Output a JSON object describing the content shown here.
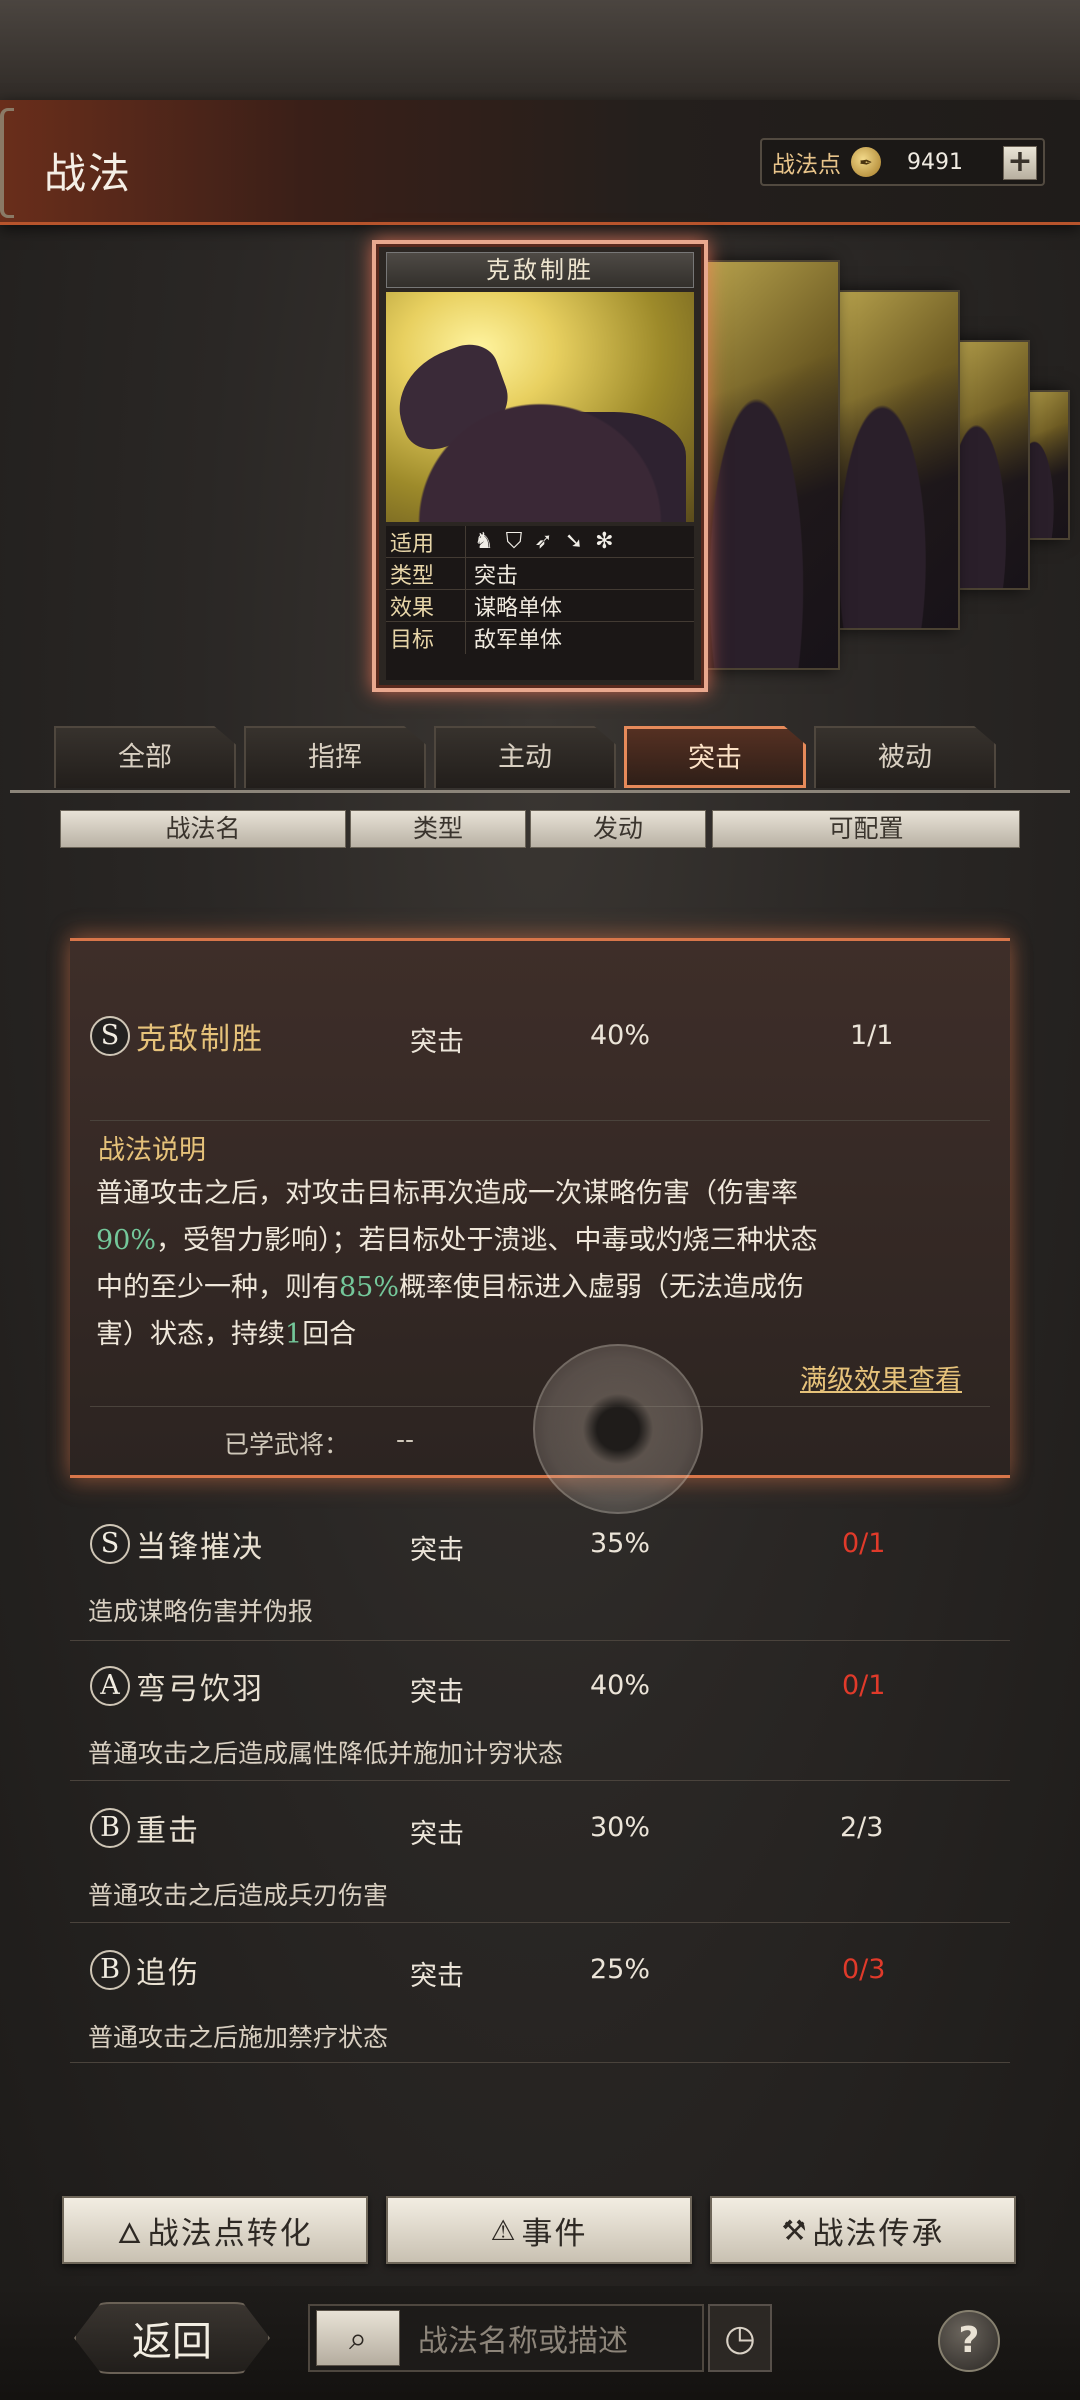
{
  "header": {
    "title": "战法",
    "points_label": "战法点",
    "points_value": "9491",
    "points_plus": "+"
  },
  "card": {
    "title": "克敌制胜",
    "rows": [
      {
        "k": "适用",
        "v": ""
      },
      {
        "k": "类型",
        "v": "突击"
      },
      {
        "k": "效果",
        "v": "谋略单体"
      },
      {
        "k": "目标",
        "v": "敌军单体"
      }
    ],
    "unit_icons": [
      "cavalry-icon",
      "shield-icon",
      "bow-icon",
      "spear-icon",
      "siege-wheel-icon"
    ]
  },
  "tabs": [
    {
      "label": "全部",
      "active": false
    },
    {
      "label": "指挥",
      "active": false
    },
    {
      "label": "主动",
      "active": false
    },
    {
      "label": "突击",
      "active": true
    },
    {
      "label": "被动",
      "active": false
    }
  ],
  "columns": [
    "战法名",
    "类型",
    "发动",
    "可配置"
  ],
  "expanded": {
    "grade": "S",
    "name": "克敌制胜",
    "type": "突击",
    "rate": "40%",
    "config": "1/1",
    "desc_title": "战法说明",
    "desc_1": "普通攻击之后，对攻击目标再次造成一次谋略伤害（伤害率",
    "desc_2a": "90%",
    "desc_2b": "，受智力影响）；若目标处于溃逃、中毒或灼烧三种状态",
    "desc_3a": "中的至少一种，则有",
    "desc_3b": "85%",
    "desc_3c": "概率使目标进入虚弱（无法造成伤",
    "desc_4a": "害）状态，持续",
    "desc_4b": "1",
    "desc_4c": "回合",
    "max_link": "满级效果查看",
    "learned_label": "已学武将：",
    "learned_value": "--"
  },
  "list": [
    {
      "grade": "S",
      "name": "当锋摧决",
      "type": "突击",
      "rate": "35%",
      "config": "0/1",
      "config_red": true,
      "desc": "造成谋略伤害并伪报"
    },
    {
      "grade": "A",
      "name": "弯弓饮羽",
      "type": "突击",
      "rate": "40%",
      "config": "0/1",
      "config_red": true,
      "desc": "普通攻击之后造成属性降低并施加计穷状态"
    },
    {
      "grade": "B",
      "name": "重击",
      "type": "突击",
      "rate": "30%",
      "config": "2/3",
      "config_red": false,
      "desc": "普通攻击之后造成兵刃伤害"
    },
    {
      "grade": "B",
      "name": "追伤",
      "type": "突击",
      "rate": "25%",
      "config": "0/3",
      "config_red": true,
      "desc": "普通攻击之后施加禁疗状态"
    }
  ],
  "buttons": {
    "convert": "战法点转化",
    "events": "事件",
    "inherit": "战法传承"
  },
  "footer": {
    "back": "返回",
    "search_placeholder": "战法名称或描述"
  },
  "colors": {
    "accent": "#d8764a",
    "gold": "#e6c27a",
    "green": "#74c79a",
    "red": "#e03a2a"
  }
}
